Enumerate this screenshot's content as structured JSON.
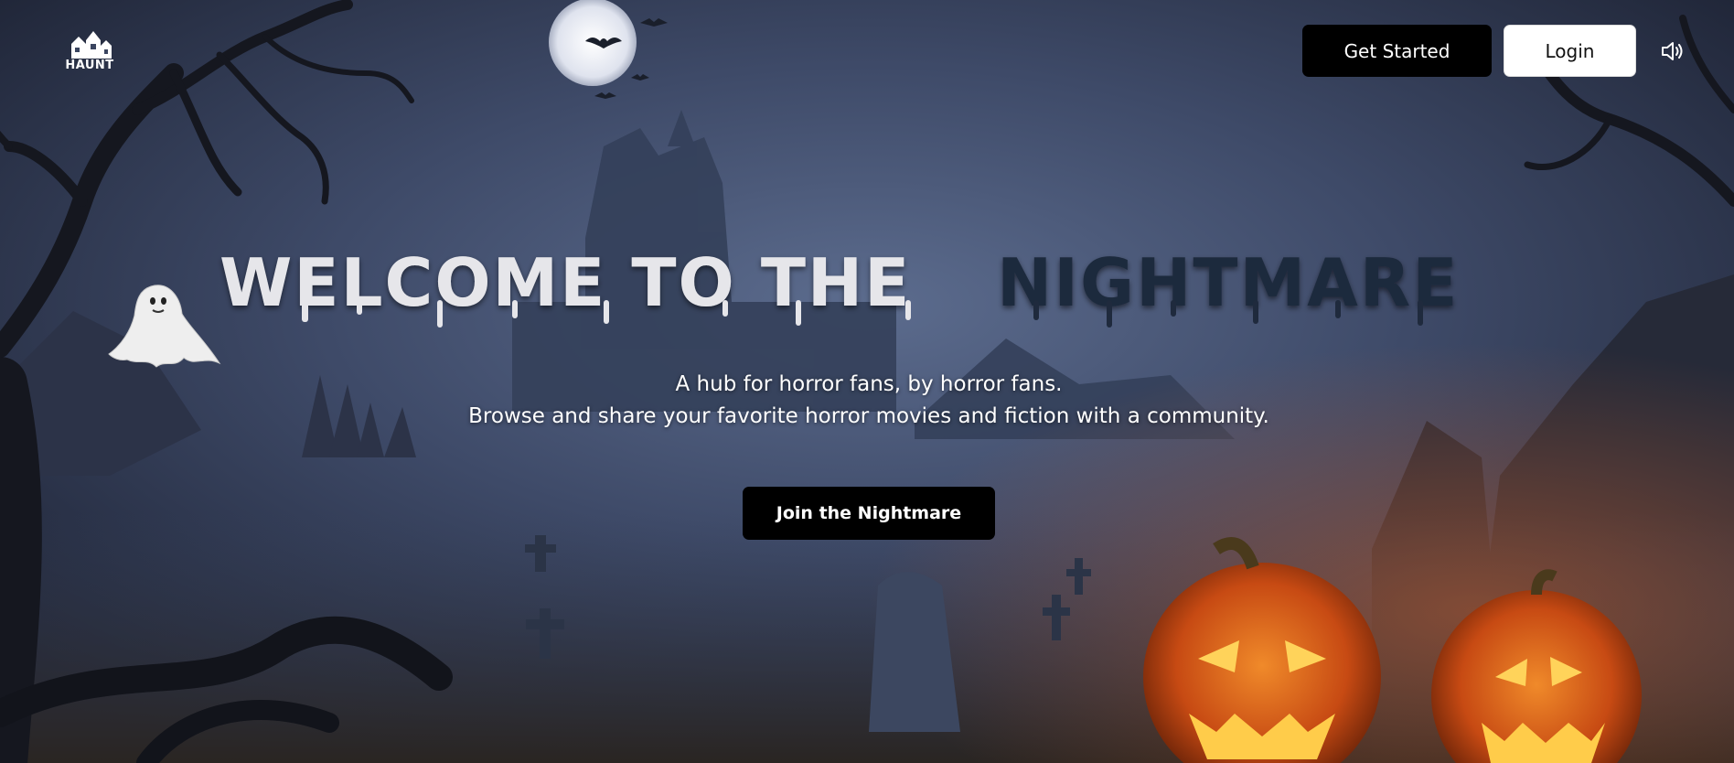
{
  "header": {
    "logo_text": "HAUNT",
    "get_started_label": "Get Started",
    "login_label": "Login",
    "sound_icon": "speaker-icon"
  },
  "hero": {
    "headline_part1": "WELCOME TO THE",
    "headline_part2": "NIGHTMARE",
    "subtitle_line1": "A hub for horror fans, by horror fans.",
    "subtitle_line2": "Browse and share your favorite horror movies and fiction with a community.",
    "cta_label": "Join the Nightmare"
  },
  "colors": {
    "accent_white": "#e6e6ea",
    "accent_dark": "#1f2a3d",
    "button_dark": "#000000",
    "button_light": "#ffffff"
  }
}
